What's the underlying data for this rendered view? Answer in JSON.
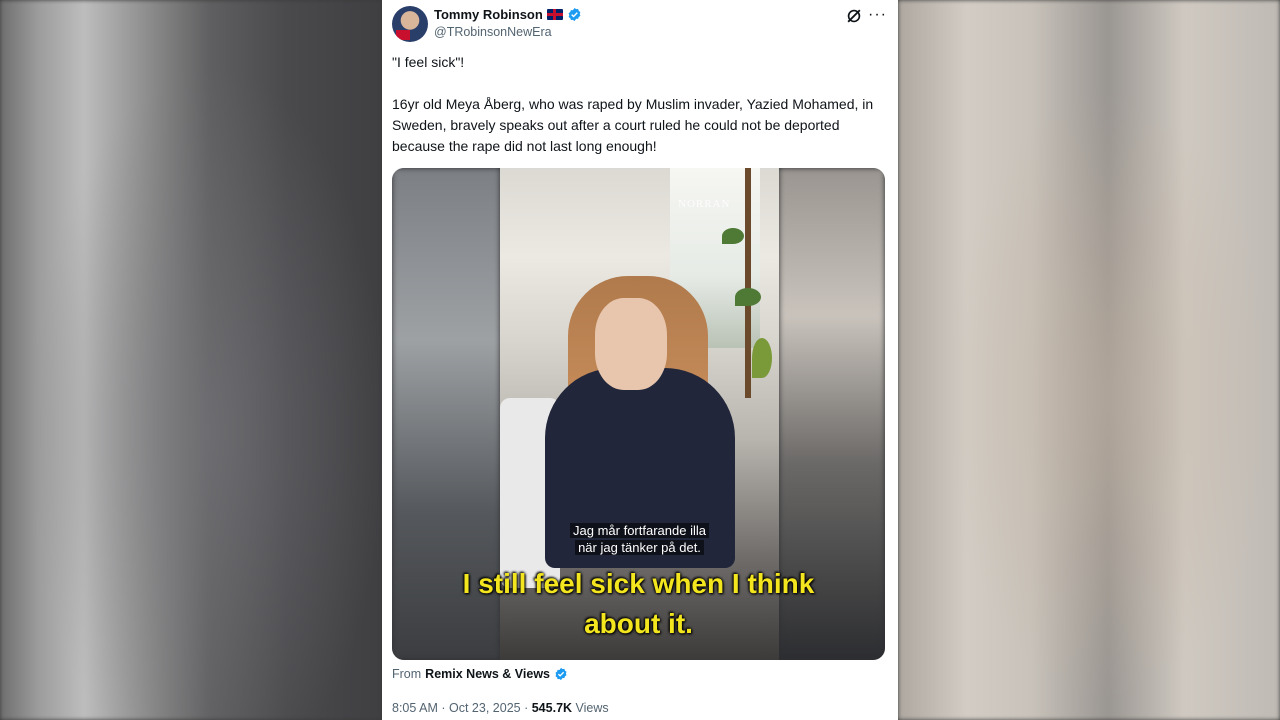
{
  "tweet": {
    "author_name": "Tommy Robinson",
    "author_handle": "@TRobinsonNewEra",
    "text_line1": "\"I feel sick\"!",
    "text_line2": "16yr old Meya Åberg, who was raped by Muslim invader, Yazied Mohamed,  in Sweden, bravely speaks out after a court ruled he could not be deported because the rape did not last long enough!",
    "more_label": "···",
    "source_prefix": "From",
    "source_name": "Remix News & Views",
    "time": "8:05 AM",
    "date": "Oct 23, 2025",
    "views_count": "545.7K",
    "views_label": "Views",
    "separator": "·"
  },
  "video": {
    "watermark": "NORRAN",
    "sub_swedish_1": "Jag mår fortfarande illa",
    "sub_swedish_2": "när jag tänker på det.",
    "sub_english_1": "I still feel sick when I think",
    "sub_english_2": "about it."
  },
  "colors": {
    "verified_blue": "#1d9bf0",
    "subtitle_yellow": "#f4e61e",
    "text_primary": "#0f1419",
    "text_secondary": "#536471"
  }
}
